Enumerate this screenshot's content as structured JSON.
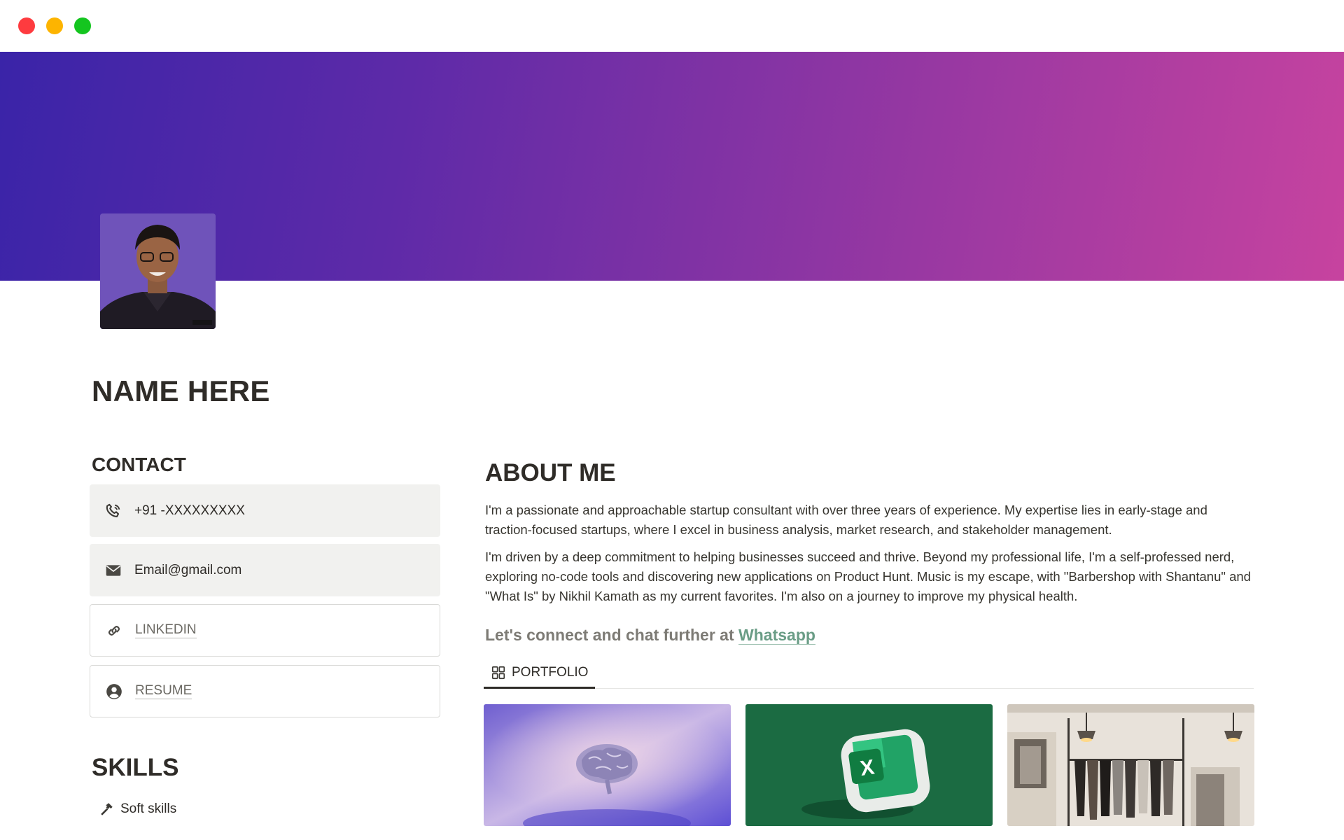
{
  "window": {
    "controls": [
      "close",
      "minimize",
      "maximize"
    ]
  },
  "cover": {
    "gradient_start": "#3a24a8",
    "gradient_end": "#c7439f"
  },
  "page": {
    "title": "NAME HERE"
  },
  "contact": {
    "heading": "CONTACT",
    "phone": {
      "icon": "phone-icon",
      "value": "+91 -XXXXXXXXX"
    },
    "email": {
      "icon": "mail-icon",
      "value": "Email@gmail.com"
    },
    "linkedin": {
      "icon": "link-icon",
      "label": "LINKEDIN"
    },
    "resume": {
      "icon": "user-circle-icon",
      "label": "RESUME"
    }
  },
  "skills": {
    "heading": "SKILLS",
    "items": [
      {
        "icon": "hammer-icon",
        "label": "Soft skills"
      }
    ]
  },
  "about": {
    "heading": "ABOUT ME",
    "paragraphs": [
      "I'm a passionate and approachable startup consultant with over three years of experience. My expertise lies in early-stage and traction-focused startups, where I excel in business analysis, market research, and stakeholder management.",
      "I'm driven by a deep commitment to helping businesses succeed and thrive. Beyond my professional life, I'm a self-professed nerd, exploring no-code tools and discovering new applications on Product Hunt. Music is my escape, with \"Barbershop with Shantanu\" and \"What Is\" by Nikhil Kamath as my current favorites. I'm also on a journey to improve my physical health."
    ],
    "connect_prefix": "Let's connect and chat further at",
    "connect_link": "Whatsapp"
  },
  "portfolio": {
    "tab_label": "PORTFOLIO",
    "tab_icon": "gallery-grid-icon",
    "cards": [
      {
        "image": "brain-image"
      },
      {
        "image": "excel-logo-image"
      },
      {
        "image": "clothing-store-image"
      }
    ]
  }
}
